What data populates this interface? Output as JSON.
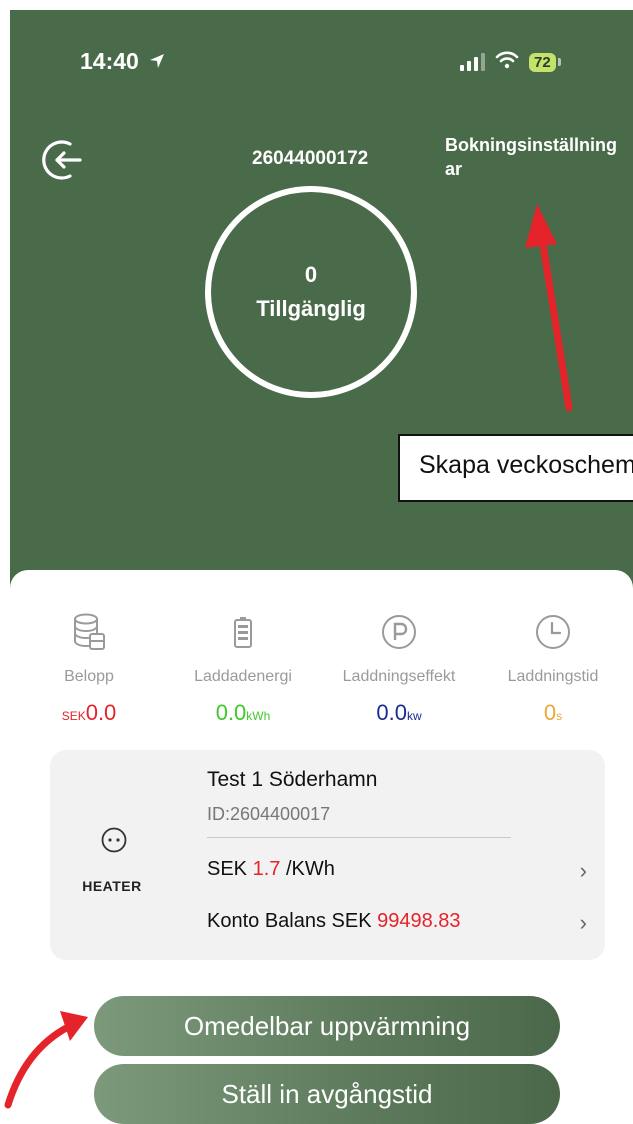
{
  "status_bar": {
    "time": "14:40",
    "battery": "72"
  },
  "header": {
    "charger_number": "26044000172",
    "booking_settings": "Bokningsinställningar"
  },
  "status_ring": {
    "count": "0",
    "label": "Tillgänglig"
  },
  "annotation": {
    "callout_text": "Skapa veckoschema"
  },
  "stats": [
    {
      "label": "Belopp",
      "prefix": "SEK",
      "value": "0.0",
      "suffix": "",
      "color": "#e4242a",
      "icon": "coins-icon"
    },
    {
      "label": "Laddadenergi",
      "prefix": "",
      "value": "0.0",
      "suffix": "kWh",
      "color": "#3fc92b",
      "icon": "battery-icon"
    },
    {
      "label": "Laddningseffekt",
      "prefix": "",
      "value": "0.0",
      "suffix": "kw",
      "color": "#1a2b8f",
      "icon": "parking-icon"
    },
    {
      "label": "Laddningstid",
      "prefix": "",
      "value": "0",
      "suffix": "s",
      "color": "#e8a93a",
      "icon": "clock-icon"
    }
  ],
  "charger_card": {
    "connector_label": "HEATER",
    "station_name": "Test 1 Söderhamn",
    "station_id": "ID:2604400017",
    "price_prefix": "SEK ",
    "price_value": "1.7",
    "price_unit": " /KWh",
    "balance_prefix": "Konto Balans SEK ",
    "balance_value": "99498.83"
  },
  "actions": {
    "heat_now": "Omedelbar uppvärmning",
    "set_departure": "Ställ in avgångstid"
  }
}
